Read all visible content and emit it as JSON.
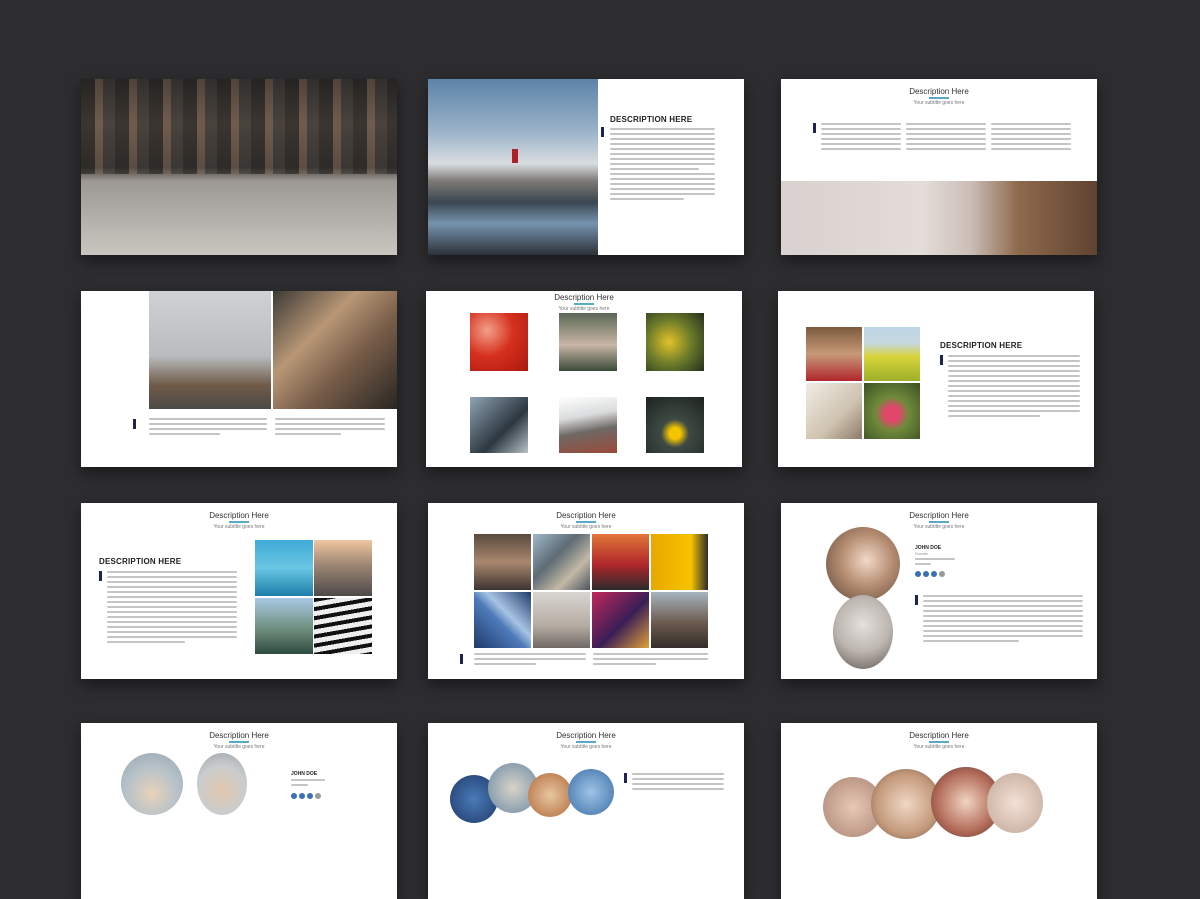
{
  "slides": {
    "s02": {
      "heading": "DESCRIPTION HERE"
    },
    "s03": {
      "title": "Description Here",
      "subtitle": "Your subtitle goes here"
    },
    "s05": {
      "title": "Description Here",
      "subtitle": "Your subtitle goes here"
    },
    "s06": {
      "heading": "DESCRIPTION HERE"
    },
    "s07": {
      "title": "Description Here",
      "subtitle": "Your subtitle goes here",
      "heading": "DESCRIPTION HERE"
    },
    "s08": {
      "title": "Description Here",
      "subtitle": "Your subtitle goes here"
    },
    "s09": {
      "title": "Description Here",
      "subtitle": "Your subtitle goes here",
      "person_name": "JOHN DOE",
      "person_role": "Founder"
    },
    "s10": {
      "title": "Description Here",
      "subtitle": "Your subtitle goes here",
      "person_name": "JOHN DOE"
    },
    "s11": {
      "title": "Description Here",
      "subtitle": "Your subtitle goes here"
    },
    "s12": {
      "title": "Description Here",
      "subtitle": "Your subtitle goes here"
    }
  },
  "colors": {
    "background": "#2d2d30",
    "accent_bar": "#1c2456",
    "underline": "#5aa9c8",
    "social_blue": "#3b6fb6"
  }
}
